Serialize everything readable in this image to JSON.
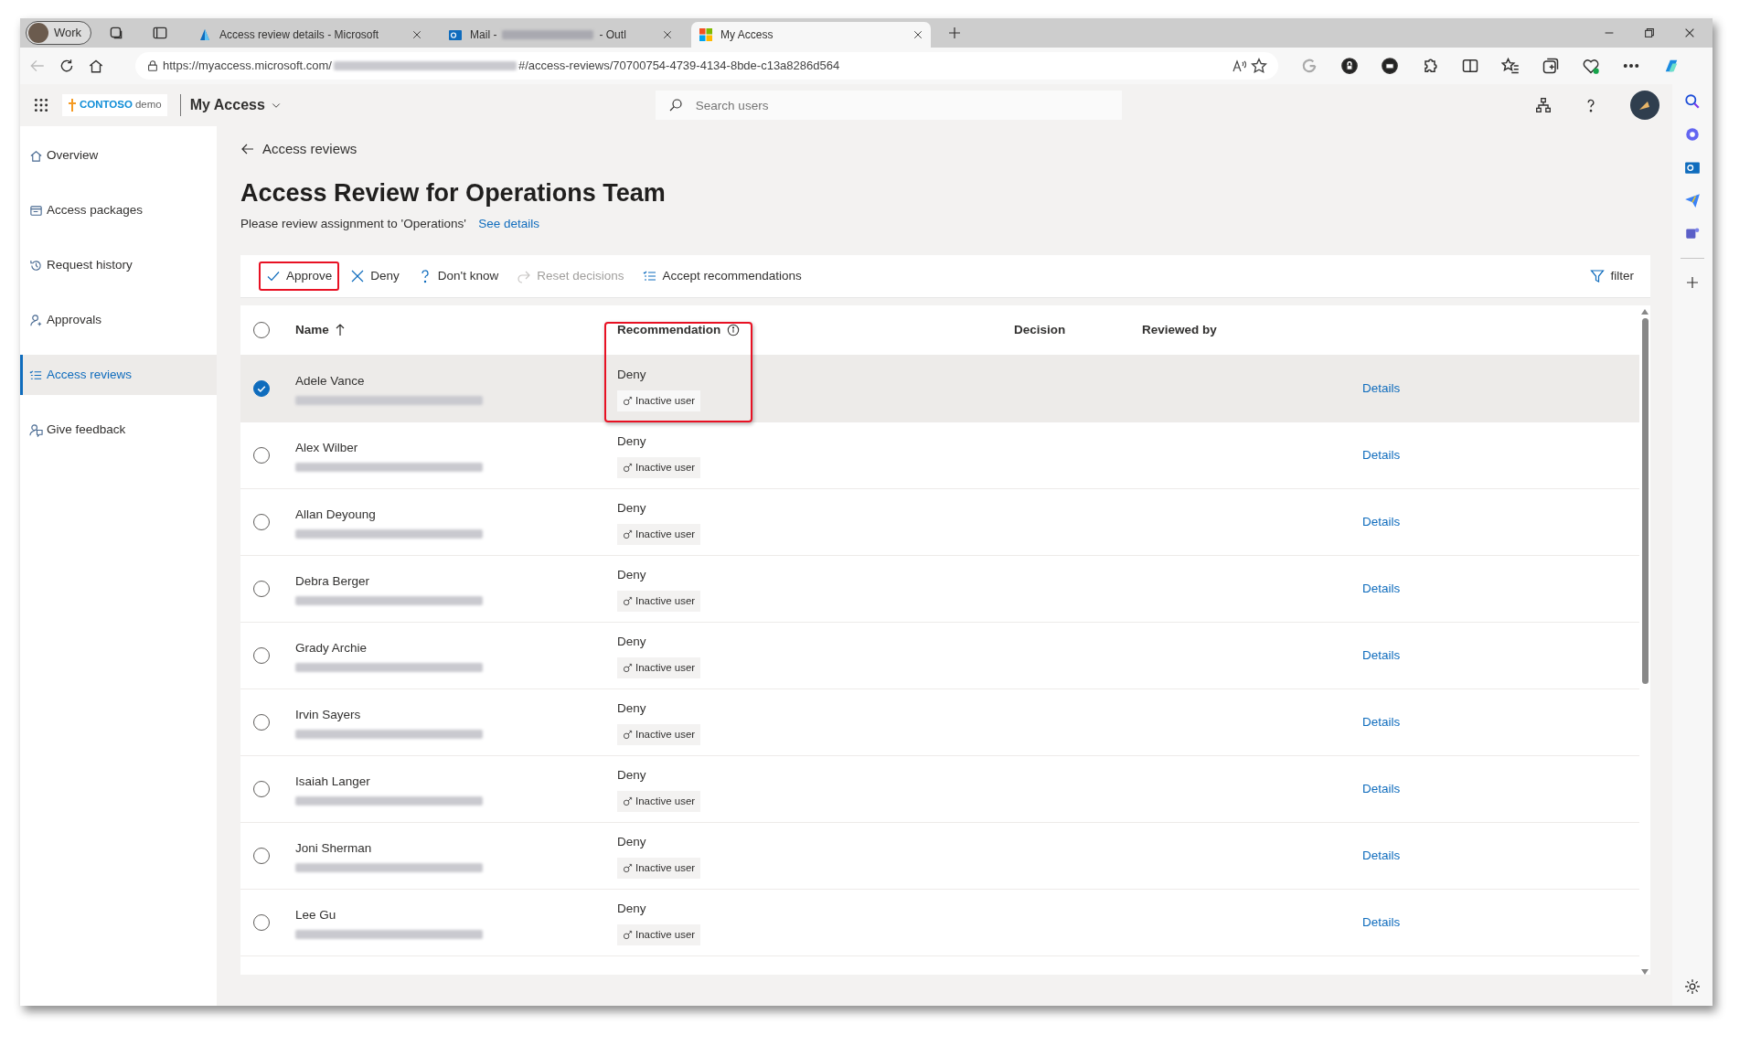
{
  "browser": {
    "profile": "Work",
    "tabs": [
      {
        "title": "Access review details - Microsoft",
        "selected": false
      },
      {
        "title": "Mail -",
        "title_end": "- Outl",
        "redacted": true,
        "selected": false
      },
      {
        "title": "My Access",
        "selected": true
      }
    ],
    "address": {
      "start": "https://myaccess.microsoft.com/",
      "end": "#/access-reviews/70700754-4739-4134-8bde-c13a8286d564",
      "redacted": true
    }
  },
  "app": {
    "logo": "CONTOSO",
    "logo_suffix": "demo",
    "name": "My Access",
    "search": {
      "placeholder": "Search users"
    }
  },
  "sidebar": {
    "items": [
      {
        "label": "Overview",
        "selected": false
      },
      {
        "label": "Access packages",
        "selected": false
      },
      {
        "label": "Request history",
        "selected": false
      },
      {
        "label": "Approvals",
        "selected": false
      },
      {
        "label": "Access reviews",
        "selected": true
      },
      {
        "label": "Give feedback",
        "selected": false
      }
    ]
  },
  "page": {
    "back": "Access reviews",
    "title": "Access Review for Operations Team",
    "subtitle": "Please review assignment to 'Operations'",
    "link": "See details"
  },
  "toolbar": {
    "actions": [
      {
        "label": "Approve",
        "disabled": false,
        "highlighted": true
      },
      {
        "label": "Deny",
        "disabled": false,
        "highlighted": false
      },
      {
        "label": "Don't know",
        "disabled": false,
        "highlighted": false
      },
      {
        "label": "Reset decisions",
        "disabled": true,
        "highlighted": false
      },
      {
        "label": "Accept recommendations",
        "disabled": false,
        "highlighted": false
      }
    ],
    "filter": "filter"
  },
  "table": {
    "select_all": {
      "checked": false
    },
    "columns": [
      {
        "label": "Name",
        "sorted": true,
        "highlighted": false
      },
      {
        "label": "Recommendation",
        "info": true,
        "highlighted": true
      },
      {
        "label": "Decision",
        "highlighted": false
      },
      {
        "label": "Reviewed by",
        "highlighted": false
      }
    ],
    "rows": [
      {
        "name": "Adele Vance",
        "selected": true,
        "recommendation": "Deny",
        "reason": "Inactive user",
        "link": "Details",
        "highlighted": true
      },
      {
        "name": "Alex Wilber",
        "selected": false,
        "recommendation": "Deny",
        "reason": "Inactive user",
        "link": "Details",
        "highlighted": false
      },
      {
        "name": "Allan Deyoung",
        "selected": false,
        "recommendation": "Deny",
        "reason": "Inactive user",
        "link": "Details",
        "highlighted": false
      },
      {
        "name": "Debra Berger",
        "selected": false,
        "recommendation": "Deny",
        "reason": "Inactive user",
        "link": "Details",
        "highlighted": false
      },
      {
        "name": "Grady Archie",
        "selected": false,
        "recommendation": "Deny",
        "reason": "Inactive user",
        "link": "Details",
        "highlighted": false
      },
      {
        "name": "Irvin Sayers",
        "selected": false,
        "recommendation": "Deny",
        "reason": "Inactive user",
        "link": "Details",
        "highlighted": false
      },
      {
        "name": "Isaiah Langer",
        "selected": false,
        "recommendation": "Deny",
        "reason": "Inactive user",
        "link": "Details",
        "highlighted": false
      },
      {
        "name": "Joni Sherman",
        "selected": false,
        "recommendation": "Deny",
        "reason": "Inactive user",
        "link": "Details",
        "highlighted": false
      },
      {
        "name": "Lee Gu",
        "selected": false,
        "recommendation": "Deny",
        "reason": "Inactive user",
        "link": "Details",
        "highlighted": false
      }
    ]
  }
}
